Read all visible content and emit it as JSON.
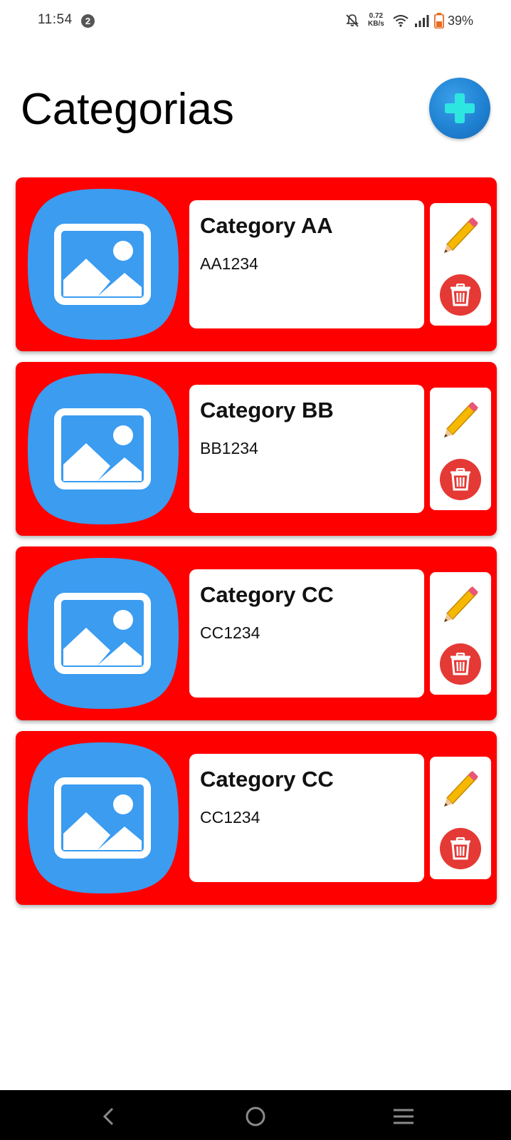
{
  "status_bar": {
    "time": "11:54",
    "notification_count": "2",
    "net_speed_value": "0.72",
    "net_speed_unit": "KB/s",
    "battery_percent": "39%"
  },
  "header": {
    "title": "Categorias",
    "add_icon": "plus-icon"
  },
  "colors": {
    "card_background": "#ff0000",
    "image_placeholder": "#3b9cf0",
    "add_button": "#1e7fd0",
    "delete_button": "#e53935",
    "pencil": "#f6b800"
  },
  "categories": [
    {
      "name": "Category AA",
      "code": "AA1234"
    },
    {
      "name": "Category BB",
      "code": "BB1234"
    },
    {
      "name": "Category CC",
      "code": "CC1234"
    },
    {
      "name": "Category CC",
      "code": "CC1234"
    }
  ],
  "card_icons": {
    "image": "image-placeholder-icon",
    "edit": "pencil-icon",
    "delete": "trash-icon"
  },
  "nav_bar": {
    "back_icon": "back-icon",
    "home_icon": "home-icon",
    "recents_icon": "recents-icon"
  }
}
